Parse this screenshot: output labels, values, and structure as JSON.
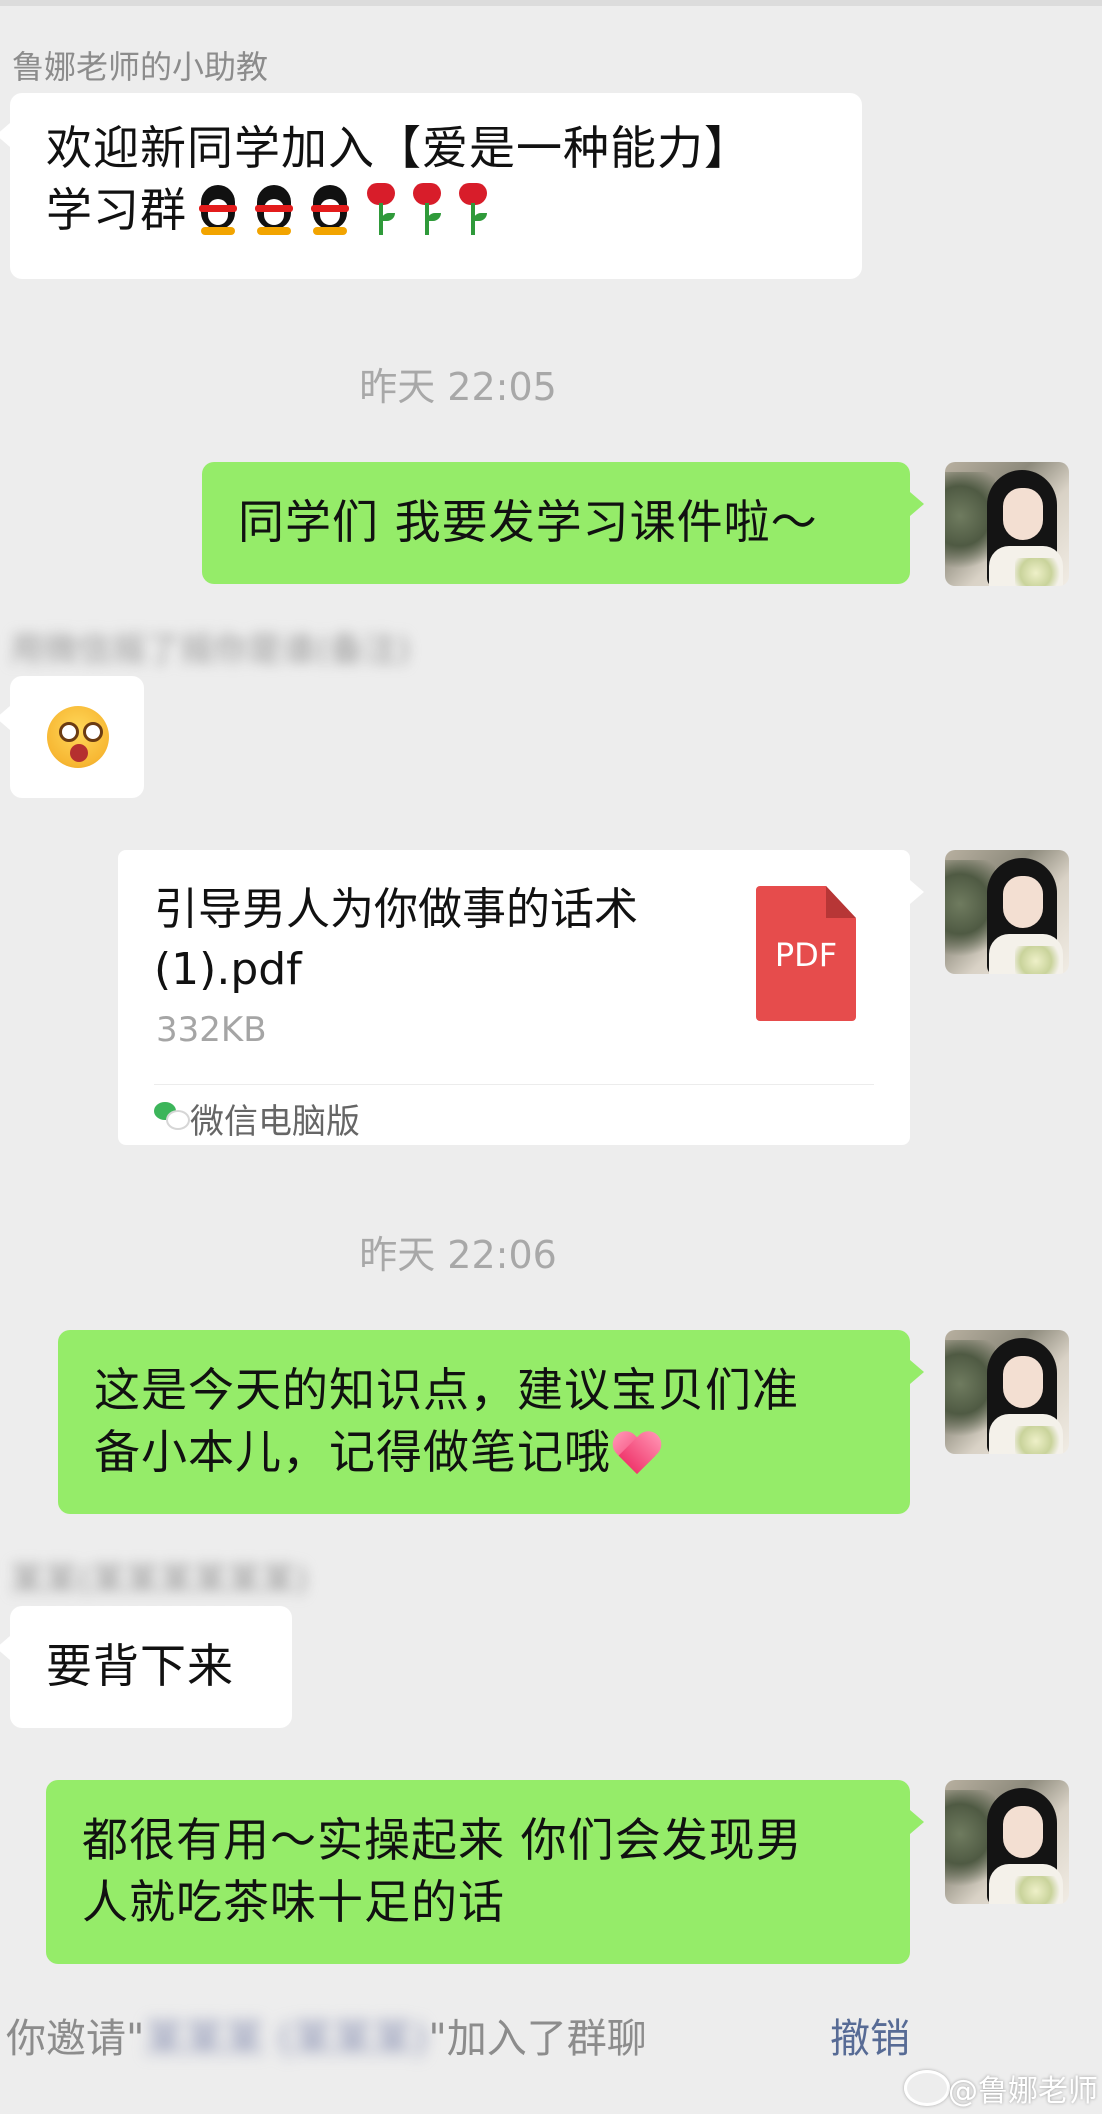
{
  "chat": {
    "sender_name": "鲁娜老师的小助教",
    "messages": {
      "welcome_line1": "欢迎新同学加入【爱是一种能力】",
      "welcome_line2": "学习群",
      "timestamp1": "昨天 22:05",
      "send_courseware": "同学们 我要发学习课件啦～",
      "blurred_sender1": "用微信摇了摇你是谁(备注)",
      "emoji_reply": "star-struck-face",
      "file_name": "引导男人为你做事的话术 (1).pdf",
      "file_size": "332KB",
      "file_source": "微信电脑版",
      "file_type_label": "PDF",
      "timestamp2": "昨天 22:06",
      "knowledge_line1": "这是今天的知识点，建议宝贝们准",
      "knowledge_line2": "备小本儿，记得做笔记哦",
      "blurred_sender2": "某某(某某某某某某)",
      "memorize": "要背下来",
      "useful_line1": "都很有用～实操起来 你们会发现男",
      "useful_line2": "人就吃茶味十足的话"
    },
    "system": {
      "invite_prefix": "你邀请\"",
      "invite_blurred": "某某某 (某某某)",
      "invite_suffix": "\"加入了群聊",
      "recall": "撤销"
    }
  },
  "watermark": "@鲁娜老师",
  "colors": {
    "background": "#ededed",
    "green_bubble": "#95ec69",
    "white_bubble": "#ffffff",
    "link": "#576b95",
    "pdf_red": "#e64c4c"
  },
  "icons": {
    "penguins": "qq-penguin-icon",
    "roses": "rose-icon",
    "heart": "pink-heart-icon",
    "wechat": "wechat-icon",
    "weibo": "weibo-icon"
  }
}
